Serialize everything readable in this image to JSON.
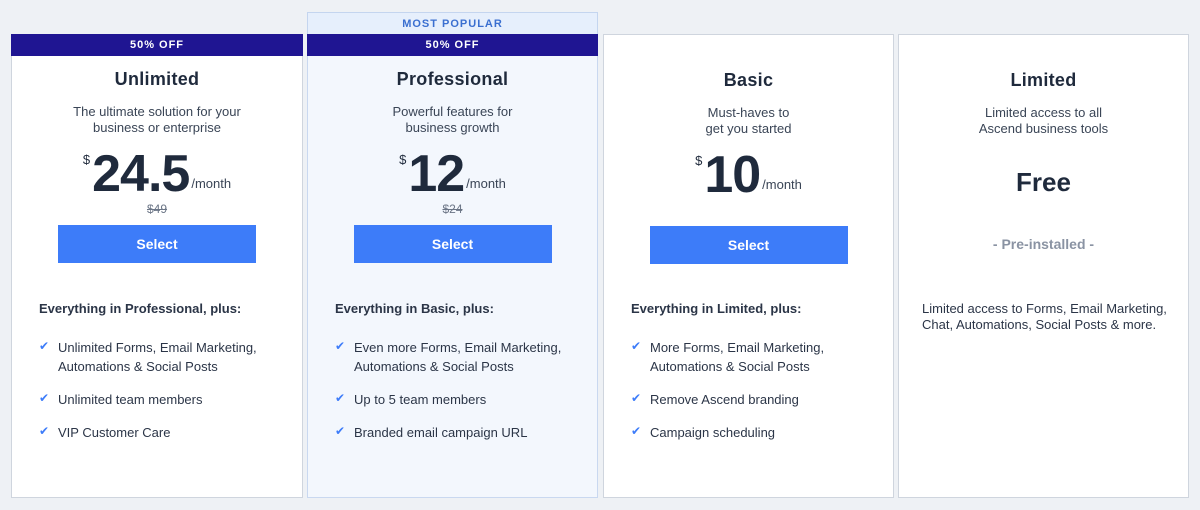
{
  "popular_label": "MOST POPULAR",
  "plans": [
    {
      "badge": "50% OFF",
      "name": "Unlimited",
      "description": "The ultimate solution for your\nbusiness or enterprise",
      "currency": "$",
      "price": "24.5",
      "period": "/month",
      "old_price": "$49",
      "button": "Select",
      "features_heading": "Everything in Professional, plus:",
      "features": [
        "Unlimited Forms, Email Marketing, Automations & Social Posts",
        "Unlimited team members",
        "VIP Customer Care"
      ]
    },
    {
      "badge": "50% OFF",
      "name": "Professional",
      "description": "Powerful features for\nbusiness growth",
      "currency": "$",
      "price": "12",
      "period": "/month",
      "old_price": "$24",
      "button": "Select",
      "features_heading": "Everything in Basic, plus:",
      "features": [
        "Even more Forms, Email Marketing, Automations & Social Posts",
        "Up to 5 team members",
        "Branded email campaign URL"
      ]
    },
    {
      "name": "Basic",
      "description": "Must-haves to\nget you started",
      "currency": "$",
      "price": "10",
      "period": "/month",
      "button": "Select",
      "features_heading": "Everything in Limited, plus:",
      "features": [
        "More Forms, Email Marketing, Automations & Social Posts",
        "Remove Ascend branding",
        "Campaign scheduling"
      ]
    },
    {
      "name": "Limited",
      "description": "Limited access to all\nAscend business tools",
      "price": "Free",
      "status": "- Pre-installed -",
      "details": "Limited access to Forms, Email Marketing, Chat, Automations, Social Posts & more."
    }
  ],
  "colors": {
    "badge_bg": "#1f1592",
    "button_bg": "#3d7cf9",
    "popular_text": "#3a6fd0",
    "page_bg": "#eef1f5"
  },
  "icons": {
    "feature_bullet": "check-icon"
  }
}
